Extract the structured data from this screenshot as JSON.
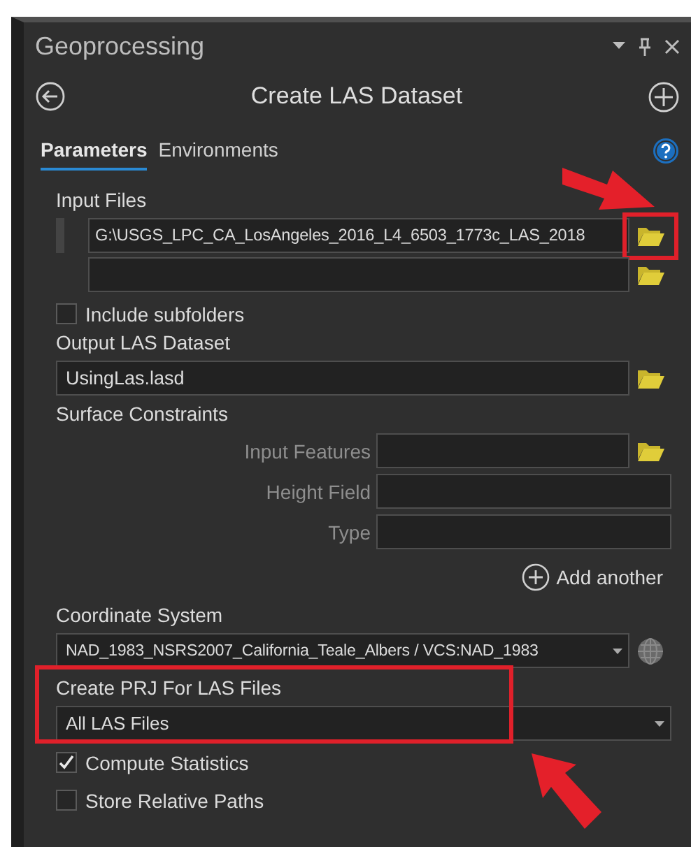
{
  "window": {
    "title": "Geoprocessing"
  },
  "tool": {
    "title": "Create LAS Dataset"
  },
  "tabs": [
    {
      "label": "Parameters",
      "selected": true
    },
    {
      "label": "Environments",
      "selected": false
    }
  ],
  "parameters": [
    {
      "kind": "multi-file",
      "label": "Input Files",
      "rows": [
        {
          "value": "G:\\USGS_LPC_CA_LosAngeles_2016_L4_6503_1773c_LAS_2018",
          "highlighted": true
        },
        {
          "highlighted": false
        }
      ]
    },
    {
      "kind": "checkbox",
      "label": "Include subfolders",
      "checked": false
    },
    {
      "kind": "file",
      "label": "Output LAS Dataset",
      "value": "UsingLas.lasd"
    },
    {
      "kind": "group",
      "label": "Surface Constraints",
      "fields": [
        {
          "label": "Input Features",
          "browse": true
        },
        {
          "label": "Height Field",
          "browse": false
        },
        {
          "label": "Type",
          "browse": false
        }
      ],
      "add_label": "Add another"
    },
    {
      "kind": "spatial-ref",
      "label": "Coordinate System",
      "value": "NAD_1983_NSRS2007_California_Teale_Albers / VCS:NAD_1983"
    },
    {
      "kind": "dropdown",
      "label": "Create PRJ For LAS Files",
      "value": "All LAS Files",
      "highlighted": true
    },
    {
      "kind": "checkbox",
      "label": "Compute Statistics",
      "checked": true
    },
    {
      "kind": "checkbox",
      "label": "Store Relative Paths",
      "checked": false
    }
  ]
}
